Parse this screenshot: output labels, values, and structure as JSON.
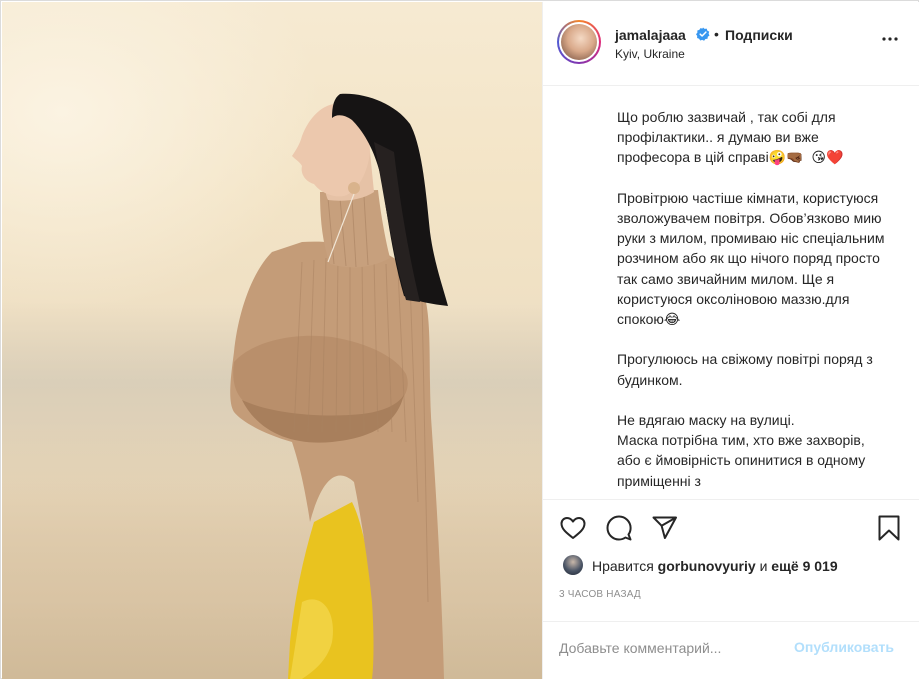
{
  "post": {
    "username": "jamalajaaa",
    "follow_label": "Подписки",
    "separator": "•",
    "location": "Kyiv, Ukraine",
    "caption": "Що роблю зазвичай , так собі для профілактики.. я думаю ви вже професора в цій справі🤪🤜🏾  😘❤️\n\nПровітрюю частіше кімнати, користуюся зволожувачем повітря. Обов’язково мию руки з милом, промиваю ніс спеціальним розчином або як що нічого поряд просто так само звичайним милом. Ще я користуюся оксоліновою маззю.для спокою😂\n\nПрогулююсь на свіжому повітрі поряд з будинком.\n\nНе вдягаю маску на вулиці.\nМаска потрібна тим, хто вже захворів, або є ймовірність опинитися в одному приміщенні з",
    "likes_prefix": "Нравится",
    "likes_user": "gorbunovyuriy",
    "likes_and": "и",
    "likes_more": "ещё 9 019",
    "timestamp": "3 часов назад"
  },
  "comment": {
    "placeholder": "Добавьте комментарий...",
    "value": "",
    "publish_label": "Опубликовать"
  },
  "colors": {
    "verified_badge": "#3897f0",
    "publish_disabled": "#b2dffc",
    "muted_text": "#8e8e8e"
  },
  "icons": [
    "verified-badge-icon",
    "more-options-icon",
    "heart-icon",
    "comment-icon",
    "share-icon",
    "bookmark-icon"
  ]
}
